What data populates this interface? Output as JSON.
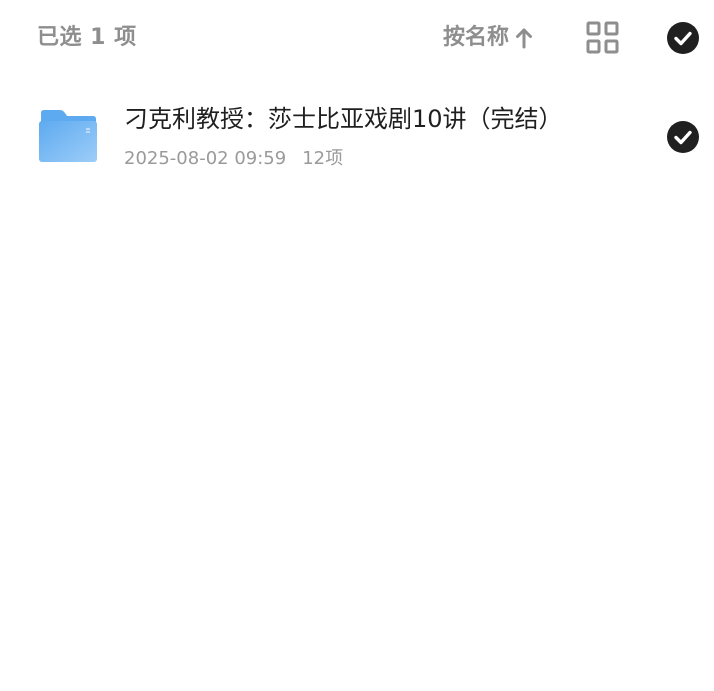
{
  "header": {
    "selection_text": "已选 1 项",
    "sort_label": "按名称",
    "sort_direction_icon": "arrow-up-icon",
    "view_toggle_icon": "grid-view-icon",
    "select_all_icon": "check-circle-icon"
  },
  "files": [
    {
      "name": "刁克利教授：莎士比亚戏剧10讲（完结）",
      "type_icon": "folder-icon",
      "modified": "2025-08-02 09:59",
      "item_count": "12项",
      "selected": true
    }
  ],
  "colors": {
    "muted_text": "#8e8e8e",
    "primary_text": "#1f1f1f",
    "check_fill": "#202020",
    "folder_light": "#9ccdf8",
    "folder_dark": "#5eaaf0"
  }
}
